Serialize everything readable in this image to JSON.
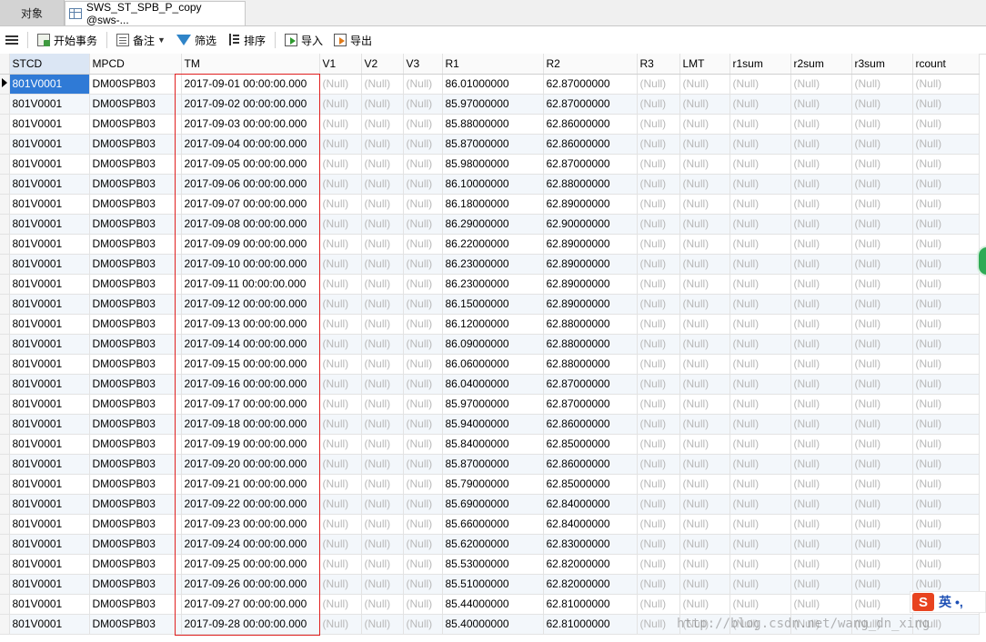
{
  "tabs": {
    "objects_label": "对象",
    "active_label": "SWS_ST_SPB_P_copy @sws-..."
  },
  "toolbar": {
    "menu_icon": "hamburger-menu-icon",
    "begin_transaction": "开始事务",
    "note": "备注",
    "filter": "筛选",
    "sort": "排序",
    "import": "导入",
    "export": "导出"
  },
  "grid": {
    "columns": [
      "STCD",
      "MPCD",
      "TM",
      "V1",
      "V2",
      "V3",
      "R1",
      "R2",
      "R3",
      "LMT",
      "r1sum",
      "r2sum",
      "r3sum",
      "rcount"
    ],
    "null_text": "(Null)",
    "rows": [
      [
        "801V0001",
        "DM00SPB03",
        "2017-09-01 00:00:00.000",
        "86.01000000",
        "62.87000000"
      ],
      [
        "801V0001",
        "DM00SPB03",
        "2017-09-02 00:00:00.000",
        "85.97000000",
        "62.87000000"
      ],
      [
        "801V0001",
        "DM00SPB03",
        "2017-09-03 00:00:00.000",
        "85.88000000",
        "62.86000000"
      ],
      [
        "801V0001",
        "DM00SPB03",
        "2017-09-04 00:00:00.000",
        "85.87000000",
        "62.86000000"
      ],
      [
        "801V0001",
        "DM00SPB03",
        "2017-09-05 00:00:00.000",
        "85.98000000",
        "62.87000000"
      ],
      [
        "801V0001",
        "DM00SPB03",
        "2017-09-06 00:00:00.000",
        "86.10000000",
        "62.88000000"
      ],
      [
        "801V0001",
        "DM00SPB03",
        "2017-09-07 00:00:00.000",
        "86.18000000",
        "62.89000000"
      ],
      [
        "801V0001",
        "DM00SPB03",
        "2017-09-08 00:00:00.000",
        "86.29000000",
        "62.90000000"
      ],
      [
        "801V0001",
        "DM00SPB03",
        "2017-09-09 00:00:00.000",
        "86.22000000",
        "62.89000000"
      ],
      [
        "801V0001",
        "DM00SPB03",
        "2017-09-10 00:00:00.000",
        "86.23000000",
        "62.89000000"
      ],
      [
        "801V0001",
        "DM00SPB03",
        "2017-09-11 00:00:00.000",
        "86.23000000",
        "62.89000000"
      ],
      [
        "801V0001",
        "DM00SPB03",
        "2017-09-12 00:00:00.000",
        "86.15000000",
        "62.89000000"
      ],
      [
        "801V0001",
        "DM00SPB03",
        "2017-09-13 00:00:00.000",
        "86.12000000",
        "62.88000000"
      ],
      [
        "801V0001",
        "DM00SPB03",
        "2017-09-14 00:00:00.000",
        "86.09000000",
        "62.88000000"
      ],
      [
        "801V0001",
        "DM00SPB03",
        "2017-09-15 00:00:00.000",
        "86.06000000",
        "62.88000000"
      ],
      [
        "801V0001",
        "DM00SPB03",
        "2017-09-16 00:00:00.000",
        "86.04000000",
        "62.87000000"
      ],
      [
        "801V0001",
        "DM00SPB03",
        "2017-09-17 00:00:00.000",
        "85.97000000",
        "62.87000000"
      ],
      [
        "801V0001",
        "DM00SPB03",
        "2017-09-18 00:00:00.000",
        "85.94000000",
        "62.86000000"
      ],
      [
        "801V0001",
        "DM00SPB03",
        "2017-09-19 00:00:00.000",
        "85.84000000",
        "62.85000000"
      ],
      [
        "801V0001",
        "DM00SPB03",
        "2017-09-20 00:00:00.000",
        "85.87000000",
        "62.86000000"
      ],
      [
        "801V0001",
        "DM00SPB03",
        "2017-09-21 00:00:00.000",
        "85.79000000",
        "62.85000000"
      ],
      [
        "801V0001",
        "DM00SPB03",
        "2017-09-22 00:00:00.000",
        "85.69000000",
        "62.84000000"
      ],
      [
        "801V0001",
        "DM00SPB03",
        "2017-09-23 00:00:00.000",
        "85.66000000",
        "62.84000000"
      ],
      [
        "801V0001",
        "DM00SPB03",
        "2017-09-24 00:00:00.000",
        "85.62000000",
        "62.83000000"
      ],
      [
        "801V0001",
        "DM00SPB03",
        "2017-09-25 00:00:00.000",
        "85.53000000",
        "62.82000000"
      ],
      [
        "801V0001",
        "DM00SPB03",
        "2017-09-26 00:00:00.000",
        "85.51000000",
        "62.82000000"
      ],
      [
        "801V0001",
        "DM00SPB03",
        "2017-09-27 00:00:00.000",
        "85.44000000",
        "62.81000000"
      ],
      [
        "801V0001",
        "DM00SPB03",
        "2017-09-28 00:00:00.000",
        "85.40000000",
        "62.81000000"
      ]
    ]
  },
  "watermark": "http://blog.csdn.net/wang_dn_xing",
  "ime": {
    "logo": "S",
    "lang": "英",
    "punct": "•,"
  },
  "colors": {
    "selection": "#2f7ad6",
    "highlight_border": "#e02020",
    "null_text": "#b8b8b8"
  }
}
